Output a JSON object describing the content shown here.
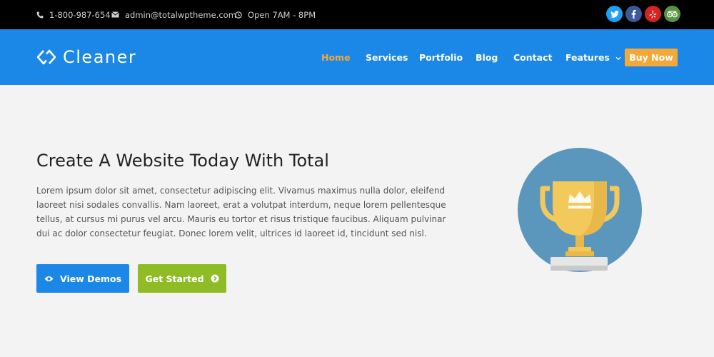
{
  "topbar": {
    "phone": "1-800-987-654",
    "email": "admin@totalwptheme.com",
    "hours": "Open 7AM - 8PM",
    "social": [
      {
        "icon": "twitter-icon",
        "color": "#1da1f2"
      },
      {
        "icon": "facebook-icon",
        "color": "#3b5998"
      },
      {
        "icon": "yelp-icon",
        "color": "#d32323"
      },
      {
        "icon": "tripadvisor-icon",
        "color": "#589442"
      }
    ]
  },
  "header": {
    "logo": "Cleaner",
    "nav": [
      "Home",
      "Services",
      "Portfolio",
      "Blog",
      "Contact",
      "Features"
    ],
    "active": "Home",
    "buy_label": "Buy Now"
  },
  "hero": {
    "title": "Create A Website Today With Total",
    "text": "Lorem ipsum dolor sit amet, consectetur adipiscing elit. Vivamus maximus nulla dolor, eleifend laoreet nisi sodales convallis. Nam laoreet, erat a volutpat interdum, neque lorem pellentesque tellus, at cursus mi purus vel arcu. Mauris eu tortor et risus tristique faucibus. Aliquam pulvinar dui ac dolor consectetur feugiat. Donec lorem velit, ultrices id laoreet id, tincidunt sed nisl.",
    "btn_demos": "View Demos",
    "btn_start": "Get Started"
  },
  "colors": {
    "topbar": "#000000",
    "header": "#1b87e6",
    "accent": "#f5a83a",
    "green": "#8fbb25",
    "background": "#f3f3f3",
    "trophy_circle": "#5b97bd",
    "trophy_gold": "#f3c95c"
  }
}
